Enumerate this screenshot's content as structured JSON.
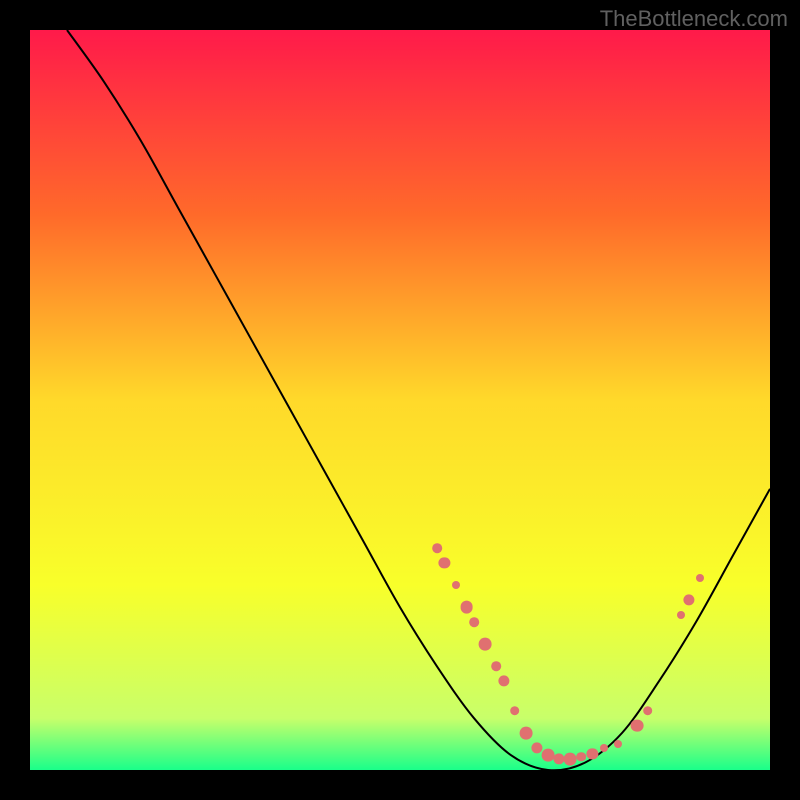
{
  "watermark": "TheBottleneck.com",
  "chart_data": {
    "type": "line",
    "title": "",
    "xlabel": "",
    "ylabel": "",
    "xlim": [
      0,
      100
    ],
    "ylim": [
      0,
      100
    ],
    "gradient_stops": [
      {
        "offset": 0,
        "color": "#ff1a4a"
      },
      {
        "offset": 25,
        "color": "#ff6a2a"
      },
      {
        "offset": 50,
        "color": "#ffd92a"
      },
      {
        "offset": 75,
        "color": "#f8ff2a"
      },
      {
        "offset": 93,
        "color": "#c8ff6a"
      },
      {
        "offset": 100,
        "color": "#1aff8a"
      }
    ],
    "curve_points": [
      {
        "x": 5,
        "y": 100
      },
      {
        "x": 10,
        "y": 93
      },
      {
        "x": 15,
        "y": 85
      },
      {
        "x": 20,
        "y": 76
      },
      {
        "x": 25,
        "y": 67
      },
      {
        "x": 30,
        "y": 58
      },
      {
        "x": 35,
        "y": 49
      },
      {
        "x": 40,
        "y": 40
      },
      {
        "x": 45,
        "y": 31
      },
      {
        "x": 50,
        "y": 22
      },
      {
        "x": 55,
        "y": 14
      },
      {
        "x": 60,
        "y": 7
      },
      {
        "x": 65,
        "y": 2
      },
      {
        "x": 70,
        "y": 0
      },
      {
        "x": 75,
        "y": 1
      },
      {
        "x": 80,
        "y": 5
      },
      {
        "x": 85,
        "y": 12
      },
      {
        "x": 90,
        "y": 20
      },
      {
        "x": 95,
        "y": 29
      },
      {
        "x": 100,
        "y": 38
      }
    ],
    "dots": [
      {
        "x": 55,
        "y": 30,
        "r": 6
      },
      {
        "x": 56,
        "y": 28,
        "r": 7
      },
      {
        "x": 57.5,
        "y": 25,
        "r": 5
      },
      {
        "x": 59,
        "y": 22,
        "r": 8
      },
      {
        "x": 60,
        "y": 20,
        "r": 6
      },
      {
        "x": 61.5,
        "y": 17,
        "r": 8
      },
      {
        "x": 63,
        "y": 14,
        "r": 6
      },
      {
        "x": 64,
        "y": 12,
        "r": 7
      },
      {
        "x": 65.5,
        "y": 8,
        "r": 6
      },
      {
        "x": 67,
        "y": 5,
        "r": 8
      },
      {
        "x": 68.5,
        "y": 3,
        "r": 7
      },
      {
        "x": 70,
        "y": 2,
        "r": 8
      },
      {
        "x": 71.5,
        "y": 1.5,
        "r": 7
      },
      {
        "x": 73,
        "y": 1.5,
        "r": 8
      },
      {
        "x": 74.5,
        "y": 1.8,
        "r": 6
      },
      {
        "x": 76,
        "y": 2.2,
        "r": 7
      },
      {
        "x": 77.5,
        "y": 3,
        "r": 5
      },
      {
        "x": 79.5,
        "y": 3.5,
        "r": 5
      },
      {
        "x": 82,
        "y": 6,
        "r": 8
      },
      {
        "x": 83.5,
        "y": 8,
        "r": 6
      },
      {
        "x": 88,
        "y": 21,
        "r": 5
      },
      {
        "x": 89,
        "y": 23,
        "r": 7
      },
      {
        "x": 90.5,
        "y": 26,
        "r": 5
      }
    ]
  }
}
